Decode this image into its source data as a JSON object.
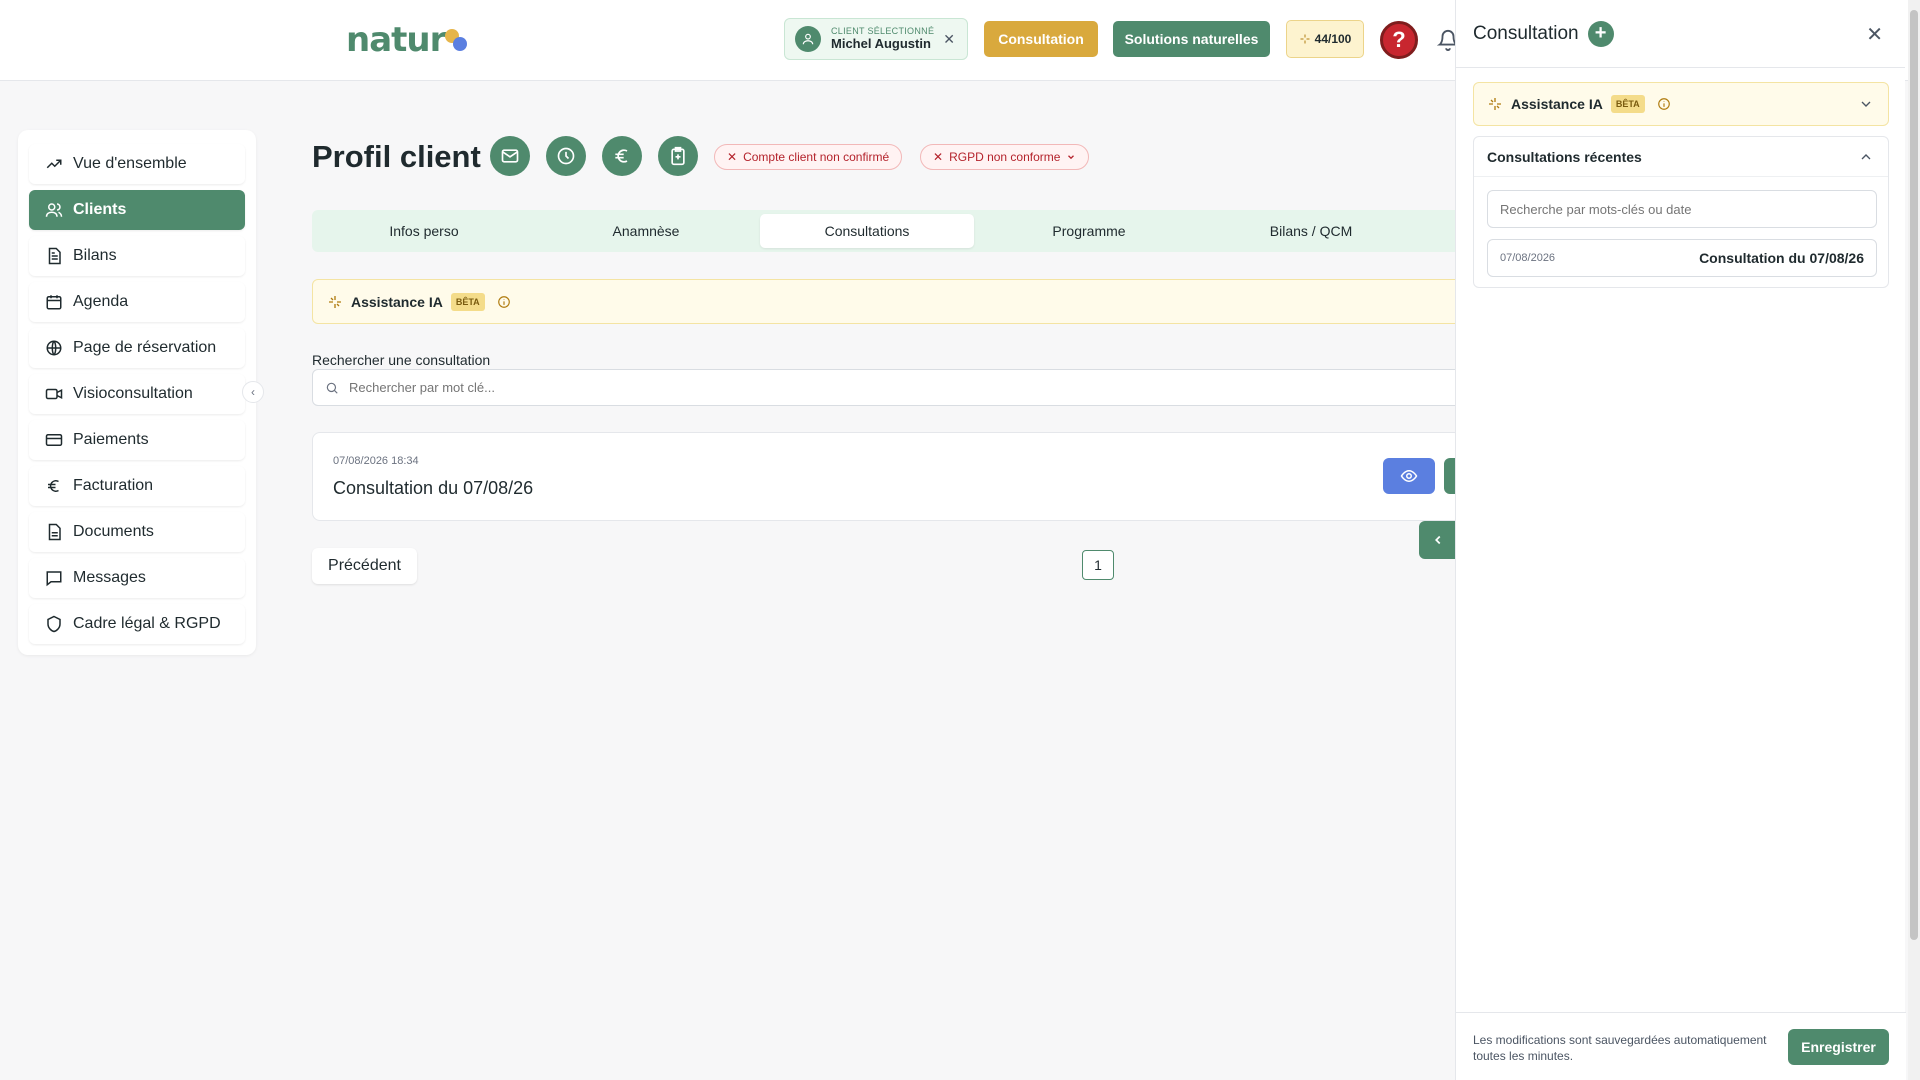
{
  "header": {
    "logo_text": "natur",
    "client": {
      "label": "CLIENT SÉLECTIONNÉ",
      "name": "Michel Augustin"
    },
    "consultation_btn": "Consultation",
    "solutions_btn": "Solutions naturelles",
    "credits": "44/100",
    "help": "?"
  },
  "sidebar": {
    "items": [
      {
        "label": "Vue d'ensemble",
        "icon": "trend-up-icon"
      },
      {
        "label": "Clients",
        "icon": "users-icon"
      },
      {
        "label": "Bilans",
        "icon": "document-icon"
      },
      {
        "label": "Agenda",
        "icon": "calendar-icon"
      },
      {
        "label": "Page de réservation",
        "icon": "globe-icon"
      },
      {
        "label": "Visioconsultation",
        "icon": "video-icon"
      },
      {
        "label": "Paiements",
        "icon": "credit-card-icon"
      },
      {
        "label": "Facturation",
        "icon": "euro-icon"
      },
      {
        "label": "Documents",
        "icon": "file-icon"
      },
      {
        "label": "Messages",
        "icon": "message-icon"
      },
      {
        "label": "Cadre légal & RGPD",
        "icon": "shield-icon"
      }
    ],
    "active_index": 1
  },
  "main": {
    "title": "Profil client",
    "tags": [
      {
        "label": "Compte client non confirmé"
      },
      {
        "label": "RGPD non conforme"
      }
    ],
    "tabs": [
      {
        "label": "Infos perso"
      },
      {
        "label": "Anamnèse"
      },
      {
        "label": "Consultations"
      },
      {
        "label": "Programme"
      },
      {
        "label": "Bilans / QCM"
      }
    ],
    "active_tab": 2,
    "ai_banner": {
      "label": "Assistance IA",
      "badge": "BÊTA"
    },
    "search": {
      "label": "Rechercher une consultation",
      "placeholder": "Rechercher par mot clé..."
    },
    "consultation": {
      "datetime": "07/08/2026 18:34",
      "title": "Consultation du 07/08/26"
    },
    "pagination": {
      "prev": "Précédent",
      "page": "1"
    }
  },
  "panel": {
    "title": "Consultation",
    "ai": {
      "label": "Assistance IA",
      "badge": "BÊTA"
    },
    "recent": {
      "title": "Consultations récentes",
      "placeholder": "Recherche par mots-clés ou date",
      "item_date": "07/08/2026",
      "item_title": "Consultation du 07/08/26"
    },
    "footer_note": "Les modifications sont sauvegardées automatiquement toutes les minutes.",
    "save_btn": "Enregistrer"
  },
  "colors": {
    "brand": "#4f8a6d",
    "accent": "#d9a93d",
    "danger": "#c8262f",
    "info": "#5b7fe0"
  }
}
